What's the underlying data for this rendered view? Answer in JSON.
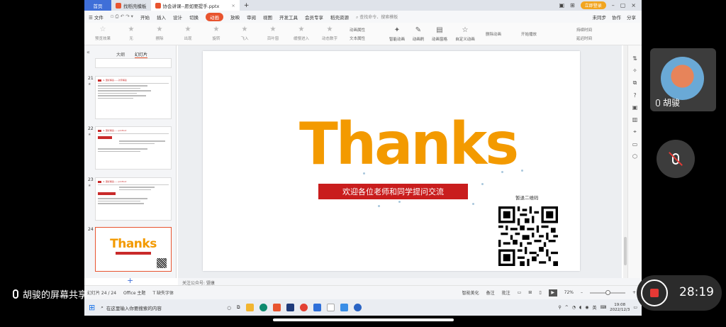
{
  "window": {
    "tabs": [
      {
        "label": "首页"
      },
      {
        "label": "找稻壳模板"
      },
      {
        "label": "协会讲课--愿如要提手.pptx"
      }
    ],
    "add_tab": "+",
    "login_label": "立即登录"
  },
  "menu": {
    "file": "文件",
    "items": [
      "开始",
      "插入",
      "设计",
      "切换",
      "动画",
      "放映",
      "审阅",
      "视图",
      "开发工具",
      "会员专享",
      "稻壳资源"
    ],
    "active": "动画",
    "search_placeholder": "查找命令、搜索模板",
    "right": [
      "未同步",
      "协作",
      "分享"
    ]
  },
  "ribbon": {
    "preview": "预览效果",
    "effects": [
      "无",
      "擦除",
      "出现",
      "旋转",
      "飞入",
      "百叶窗",
      "缓慢进入",
      "动态数字"
    ],
    "props": [
      "动画属性",
      "文本属性"
    ],
    "tools": [
      "智能动画",
      "动画刷",
      "动画窗格",
      "自定义动画",
      "删除动画"
    ],
    "timing": [
      "开始播放",
      "持续时间",
      "延迟时间"
    ]
  },
  "panel": {
    "tabs": [
      "大纲",
      "幻灯片"
    ],
    "active_tab": "幻灯片",
    "slides": [
      {
        "num": "21",
        "title": "4. 国标解读——对手解读"
      },
      {
        "num": "22",
        "title": "4. 国标解读——proficut"
      },
      {
        "num": "23",
        "title": "4. 国标解读——proficut"
      },
      {
        "num": "24",
        "thanks": "Thanks"
      }
    ]
  },
  "slide": {
    "title": "Thanks",
    "subtitle": "欢迎各位老师和同学提问交流",
    "qr_label": "暂退二维码"
  },
  "notes": "关注公众号: 暨康",
  "status": {
    "slide_count": "幻灯片 24 / 24",
    "theme": "Office 主题",
    "missing_font": "缺失字体",
    "beautify": "智能美化",
    "notes_btn": "备注",
    "comments_btn": "批注",
    "zoom": "72%"
  },
  "taskbar": {
    "search_placeholder": "在这里输入你要搜索的内容",
    "ime": "英",
    "time": "19:08",
    "date": "2022/12/3"
  },
  "meeting": {
    "share_label": "胡骏的屏幕共享",
    "participant_name": "胡骏",
    "recording_time": "28:19"
  }
}
